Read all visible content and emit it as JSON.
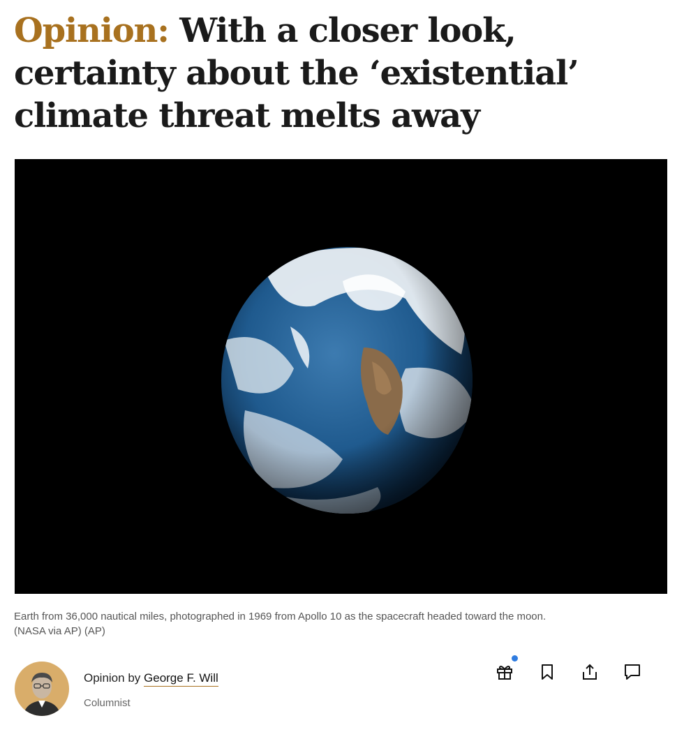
{
  "article": {
    "kicker": "Opinion:",
    "headline": "With a closer look, certainty about the ‘existential’ climate threat melts away"
  },
  "hero_image": {
    "subject": "Earth from space",
    "caption_line1": "Earth from 36,000 nautical miles, photographed in 1969 from Apollo 10 as the spacecraft headed toward the moon.",
    "caption_line2": "(NASA via AP) (AP)"
  },
  "byline": {
    "prefix": "Opinion by",
    "author": "George F. Will",
    "role": "Columnist"
  },
  "actions": {
    "items": [
      "gift-icon",
      "bookmark-icon",
      "share-icon",
      "comment-icon"
    ],
    "notification_color": "#2f7ce0"
  },
  "colors": {
    "kicker": "#a8711f",
    "avatar_bg": "#d9ad6a"
  }
}
